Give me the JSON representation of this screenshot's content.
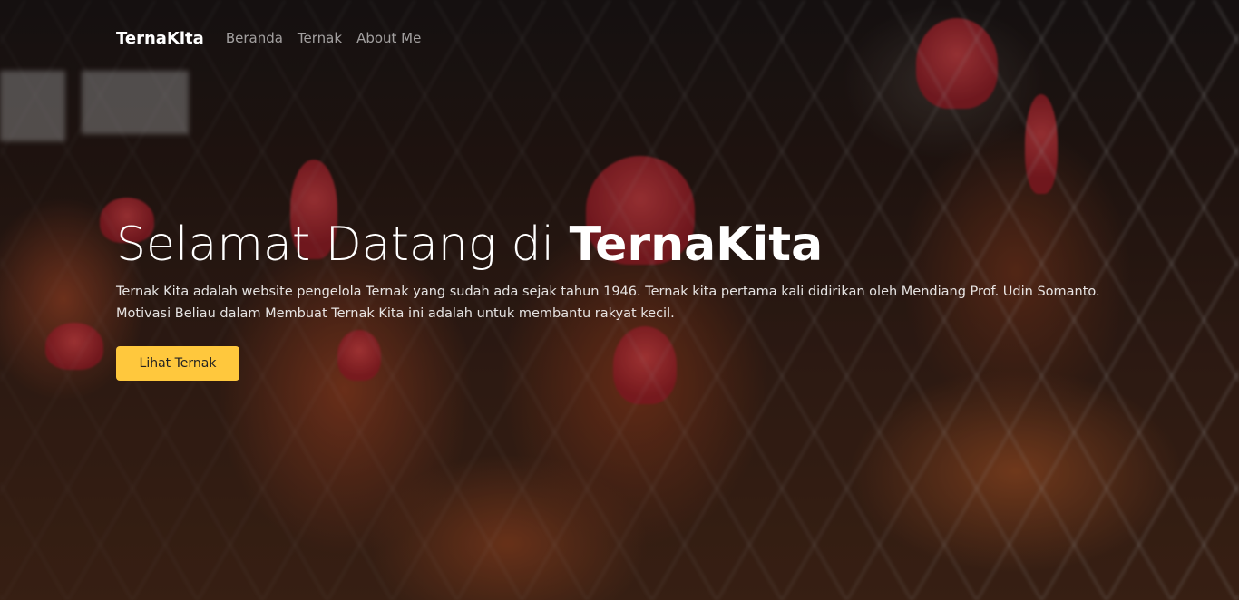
{
  "brand": "TernaKita",
  "nav": {
    "items": [
      {
        "label": "Beranda"
      },
      {
        "label": "Ternak"
      },
      {
        "label": "About Me"
      }
    ]
  },
  "hero": {
    "title_prefix": "Selamat Datang di ",
    "title_emphasis": "TernaKita",
    "description": "Ternak Kita adalah website pengelola Ternak yang sudah ada sejak tahun 1946. Ternak kita pertama kali didirikan oleh Mendiang Prof. Udin Somanto. Motivasi Beliau dalam Membuat Ternak Kita ini adalah untuk membantu rakyat kecil.",
    "cta_label": "Lihat Ternak"
  },
  "colors": {
    "accent": "#ffc83d",
    "text": "#ffffff"
  }
}
